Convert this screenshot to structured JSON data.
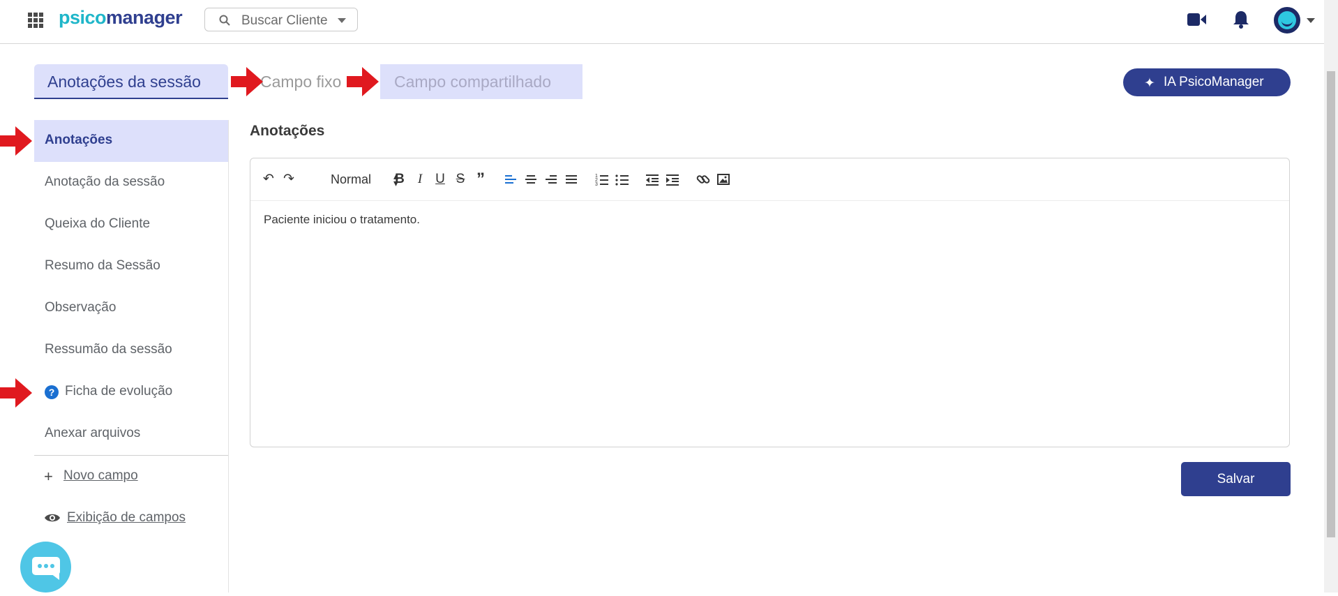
{
  "header": {
    "logo_part1": "psico",
    "logo_part2": "manager",
    "search_placeholder": "Buscar Cliente",
    "icons": [
      "apps-grid-icon",
      "search-icon",
      "video-camera-icon",
      "bell-icon",
      "avatar",
      "chevron-down-icon"
    ]
  },
  "tabs": {
    "active": "Anotações da sessão",
    "fixed": "Campo fixo",
    "shared": "Campo compartilhado"
  },
  "ai_button": {
    "label": "IA PsicoManager",
    "icon": "sparkle-icon"
  },
  "sidebar": {
    "items": [
      {
        "label": "Anotações",
        "active": true
      },
      {
        "label": "Anotação da sessão",
        "active": false
      },
      {
        "label": "Queixa do Cliente",
        "active": false
      },
      {
        "label": "Resumo da Sessão",
        "active": false
      },
      {
        "label": "Observação",
        "active": false
      },
      {
        "label": "Ressumão da sessão",
        "active": false
      },
      {
        "label": "Ficha de evolução",
        "active": false,
        "icon": "help-icon"
      },
      {
        "label": "Anexar arquivos",
        "active": false
      }
    ],
    "new_field": "Novo campo",
    "show_fields": "Exibição de campos"
  },
  "editor": {
    "title": "Anotações",
    "format": "Normal",
    "content": "Paciente iniciou o tratamento."
  },
  "save_label": "Salvar",
  "colors": {
    "brand_primary": "#2f3f8f",
    "brand_accent": "#1fb6c9",
    "active_bg": "#dde0fb",
    "annotation_arrow": "#e0191f"
  }
}
